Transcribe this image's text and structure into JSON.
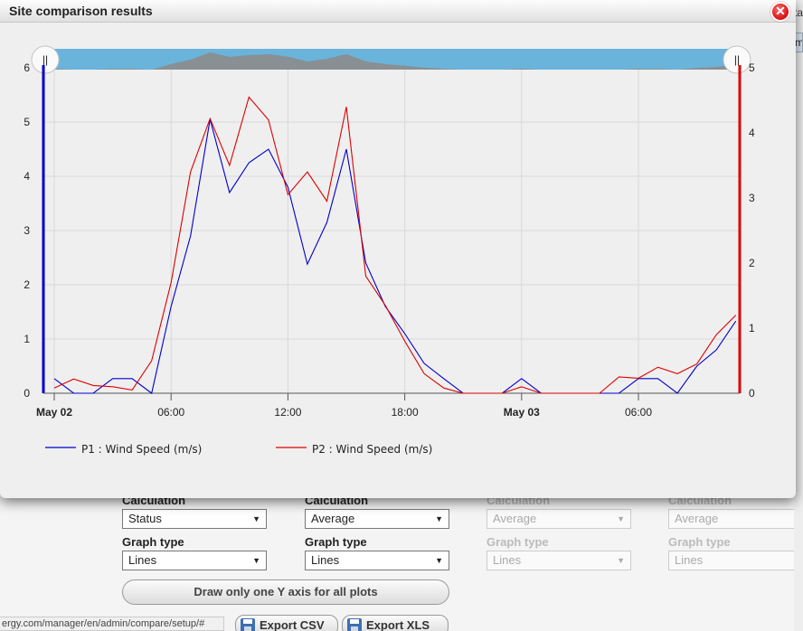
{
  "modal": {
    "title": "Site comparison results",
    "close_icon": "close-icon"
  },
  "chart_data": {
    "type": "line",
    "title": "",
    "x_start": "May 02 00:00",
    "x_tick_labels": [
      "May 02",
      "06:00",
      "12:00",
      "18:00",
      "May 03",
      "06:00"
    ],
    "x_tick_hours": [
      0,
      6,
      12,
      18,
      24,
      30
    ],
    "x_range_hours": [
      0,
      36
    ],
    "left_axis": {
      "ticks": [
        0,
        1,
        2,
        3,
        4,
        5,
        6
      ],
      "ylim": [
        0,
        6
      ],
      "color": "#0000cc"
    },
    "right_axis": {
      "ticks": [
        0,
        1,
        2,
        3,
        4,
        5
      ],
      "ylim": [
        0,
        5
      ],
      "color": "#dd0000"
    },
    "grid": true,
    "legend_position": "bottom",
    "series": [
      {
        "name": "P1 : Wind Speed (m/s)",
        "axis": "left",
        "color": "#0000cc",
        "x_hours": [
          0,
          1,
          2,
          3,
          4,
          5,
          6,
          7,
          8,
          9,
          10,
          11,
          12,
          13,
          14,
          15,
          16,
          17,
          18,
          19,
          20,
          21,
          22,
          23,
          24,
          25,
          26,
          27,
          28,
          29,
          30,
          31,
          32,
          33,
          34,
          35
        ],
        "values": [
          0.27,
          0,
          0,
          0.27,
          0.27,
          0,
          1.6,
          2.9,
          5.05,
          3.7,
          4.25,
          4.5,
          3.8,
          2.38,
          3.15,
          4.5,
          2.4,
          1.6,
          1.1,
          0.55,
          0.27,
          0,
          0,
          0,
          0.27,
          0,
          0,
          0,
          0,
          0,
          0.27,
          0.27,
          0,
          0.5,
          0.8,
          1.33
        ]
      },
      {
        "name": "P2 : Wind Speed (m/s)",
        "axis": "right",
        "color": "#dd0000",
        "x_hours": [
          0,
          1,
          2,
          3,
          4,
          5,
          6,
          7,
          8,
          9,
          10,
          11,
          12,
          13,
          14,
          15,
          16,
          17,
          18,
          19,
          20,
          21,
          22,
          23,
          24,
          25,
          26,
          27,
          28,
          29,
          30,
          31,
          32,
          33,
          34,
          35
        ],
        "values": [
          0.08,
          0.22,
          0.12,
          0.1,
          0.05,
          0.5,
          1.7,
          3.4,
          4.22,
          3.5,
          4.55,
          4.2,
          3.05,
          3.4,
          2.95,
          4.4,
          1.8,
          1.35,
          0.8,
          0.3,
          0.08,
          0,
          0,
          0,
          0.1,
          0,
          0,
          0,
          0,
          0.25,
          0.23,
          0.4,
          0.3,
          0.45,
          0.9,
          1.2
        ]
      }
    ],
    "navigator": {
      "bar_color": "#6ab4dc",
      "left_handle_label": "||",
      "right_handle_label": "||"
    }
  },
  "background": {
    "columns": [
      {
        "calc_label": "Calculation",
        "calc_value": "Status",
        "graph_label": "Graph type",
        "graph_value": "Lines",
        "enabled": true
      },
      {
        "calc_label": "Calculation",
        "calc_value": "Average",
        "graph_label": "Graph type",
        "graph_value": "Lines",
        "enabled": true
      },
      {
        "calc_label": "Calculation",
        "calc_value": "Average",
        "graph_label": "Graph type",
        "graph_value": "Lines",
        "enabled": false
      },
      {
        "calc_label": "Calculation",
        "calc_value": "Average",
        "graph_label": "Graph type",
        "graph_value": "Lines",
        "enabled": false
      }
    ],
    "one_axis_button": "Draw only one Y axis for all plots",
    "status_url": "ergy.com/manager/en/admin/compare/setup/#",
    "export_csv": "Export CSV",
    "export_xls": "Export XLS",
    "right_edge_text_1": "ta",
    "right_edge_text_2": "m"
  }
}
